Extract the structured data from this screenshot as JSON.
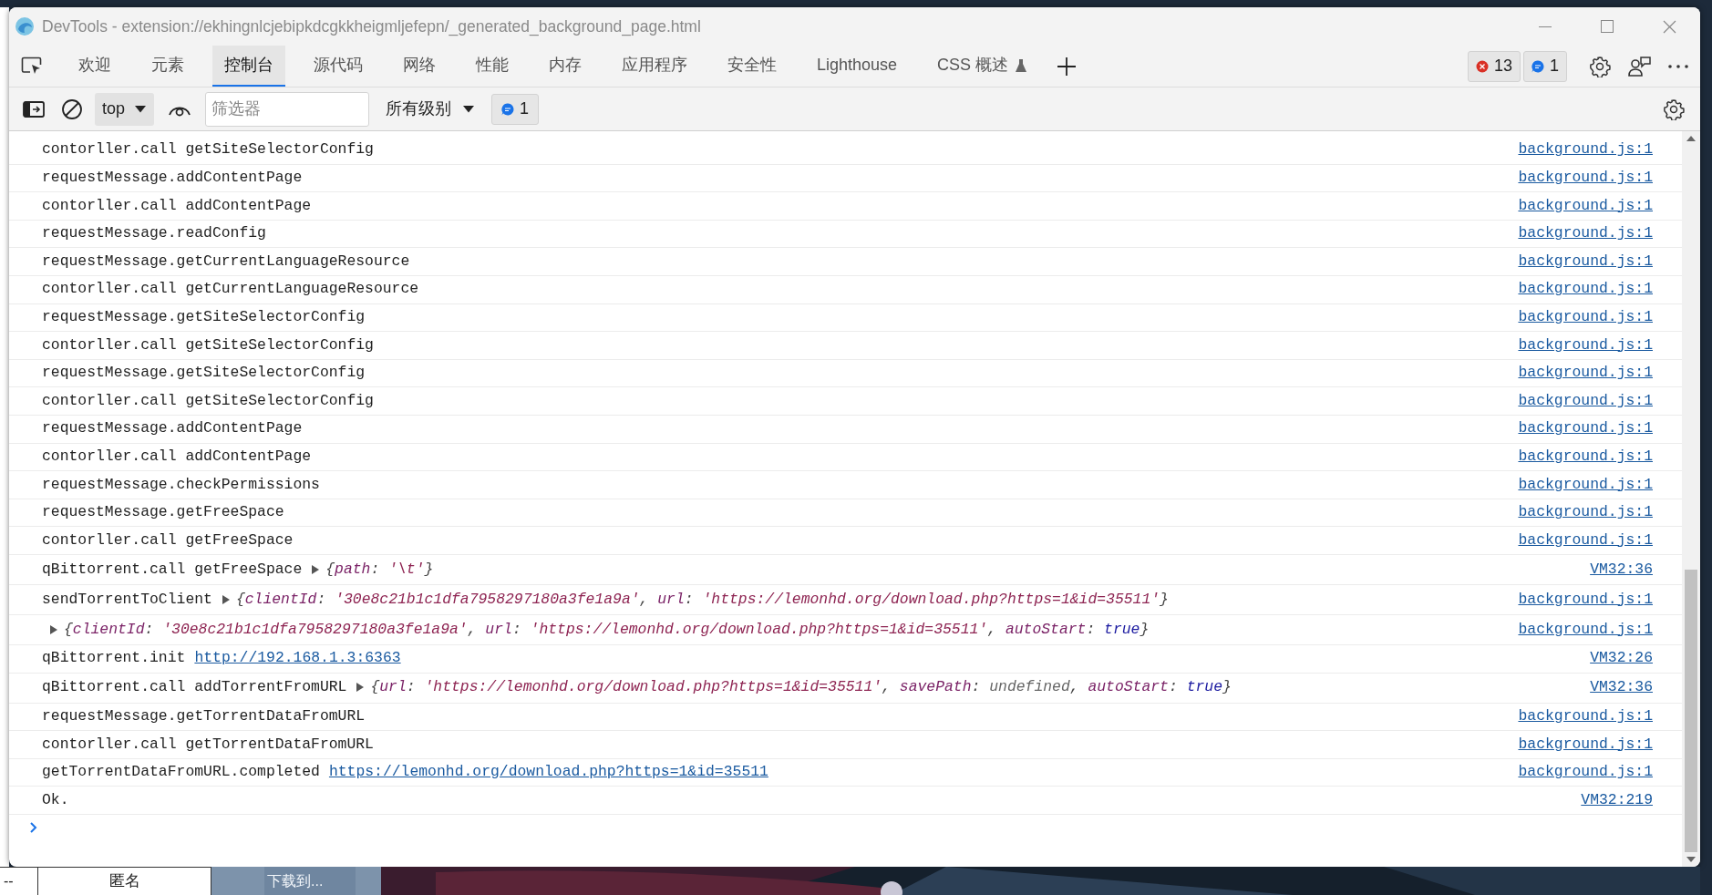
{
  "window": {
    "title": "DevTools - extension://ekhingnlcjebipkdcgkkheigmljefepn/_generated_background_page.html"
  },
  "tabs": [
    {
      "label": "欢迎",
      "selected": false,
      "kind": "plain"
    },
    {
      "label": "元素",
      "selected": false,
      "kind": "plain"
    },
    {
      "label": "控制台",
      "selected": true,
      "kind": "plain"
    },
    {
      "label": "源代码",
      "selected": false,
      "kind": "plain"
    },
    {
      "label": "网络",
      "selected": false,
      "kind": "plain"
    },
    {
      "label": "性能",
      "selected": false,
      "kind": "plain"
    },
    {
      "label": "内存",
      "selected": false,
      "kind": "plain"
    },
    {
      "label": "应用程序",
      "selected": false,
      "kind": "plain"
    },
    {
      "label": "安全性",
      "selected": false,
      "kind": "plain"
    },
    {
      "label": "Lighthouse",
      "selected": false,
      "kind": "plain"
    },
    {
      "label": "CSS 概述",
      "selected": false,
      "kind": "experimental"
    }
  ],
  "status_badges": [
    {
      "kind": "error",
      "count": "13"
    },
    {
      "kind": "info",
      "count": "1"
    }
  ],
  "toolbar": {
    "context": "top",
    "filter_placeholder": "筛选器",
    "levels": "所有级别",
    "message_badge": "1"
  },
  "messages": [
    {
      "parts": [
        {
          "kind": "text",
          "text": "contorller.call getSiteSelectorConfig"
        }
      ],
      "source": "background.js:1"
    },
    {
      "parts": [
        {
          "kind": "text",
          "text": "requestMessage.addContentPage"
        }
      ],
      "source": "background.js:1"
    },
    {
      "parts": [
        {
          "kind": "text",
          "text": "contorller.call addContentPage"
        }
      ],
      "source": "background.js:1"
    },
    {
      "parts": [
        {
          "kind": "text",
          "text": "requestMessage.readConfig"
        }
      ],
      "source": "background.js:1"
    },
    {
      "parts": [
        {
          "kind": "text",
          "text": "requestMessage.getCurrentLanguageResource"
        }
      ],
      "source": "background.js:1"
    },
    {
      "parts": [
        {
          "kind": "text",
          "text": "contorller.call getCurrentLanguageResource"
        }
      ],
      "source": "background.js:1"
    },
    {
      "parts": [
        {
          "kind": "text",
          "text": "requestMessage.getSiteSelectorConfig"
        }
      ],
      "source": "background.js:1"
    },
    {
      "parts": [
        {
          "kind": "text",
          "text": "contorller.call getSiteSelectorConfig"
        }
      ],
      "source": "background.js:1"
    },
    {
      "parts": [
        {
          "kind": "text",
          "text": "requestMessage.getSiteSelectorConfig"
        }
      ],
      "source": "background.js:1"
    },
    {
      "parts": [
        {
          "kind": "text",
          "text": "contorller.call getSiteSelectorConfig"
        }
      ],
      "source": "background.js:1"
    },
    {
      "parts": [
        {
          "kind": "text",
          "text": "requestMessage.addContentPage"
        }
      ],
      "source": "background.js:1"
    },
    {
      "parts": [
        {
          "kind": "text",
          "text": "contorller.call addContentPage"
        }
      ],
      "source": "background.js:1"
    },
    {
      "parts": [
        {
          "kind": "text",
          "text": "requestMessage.checkPermissions"
        }
      ],
      "source": "background.js:1"
    },
    {
      "parts": [
        {
          "kind": "text",
          "text": "requestMessage.getFreeSpace"
        }
      ],
      "source": "background.js:1"
    },
    {
      "parts": [
        {
          "kind": "text",
          "text": "contorller.call getFreeSpace"
        }
      ],
      "source": "background.js:1"
    },
    {
      "parts": [
        {
          "kind": "text",
          "text": "qBittorrent.call getFreeSpace"
        },
        {
          "kind": "object",
          "expanded": false,
          "tokens": [
            {
              "kind": "punct",
              "text": "{"
            },
            {
              "kind": "key",
              "text": "path"
            },
            {
              "kind": "punct",
              "text": ": "
            },
            {
              "kind": "string",
              "text": "'\\t'"
            },
            {
              "kind": "punct",
              "text": "}"
            }
          ]
        }
      ],
      "source": "VM32:36"
    },
    {
      "parts": [
        {
          "kind": "text",
          "text": "sendTorrentToClient"
        },
        {
          "kind": "object",
          "expanded": false,
          "tokens": [
            {
              "kind": "punct",
              "text": "{"
            },
            {
              "kind": "key",
              "text": "clientId"
            },
            {
              "kind": "punct",
              "text": ": "
            },
            {
              "kind": "string",
              "text": "'30e8c21b1c1dfa7958297180a3fe1a9a'"
            },
            {
              "kind": "punct",
              "text": ", "
            },
            {
              "kind": "key",
              "text": "url"
            },
            {
              "kind": "punct",
              "text": ": "
            },
            {
              "kind": "string",
              "text": "'https://lemonhd.org/download.php?https=1&id=35511'"
            },
            {
              "kind": "punct",
              "text": "}"
            }
          ]
        }
      ],
      "source": "background.js:1"
    },
    {
      "parts": [
        {
          "kind": "object",
          "expanded": false,
          "tokens": [
            {
              "kind": "punct",
              "text": "{"
            },
            {
              "kind": "key",
              "text": "clientId"
            },
            {
              "kind": "punct",
              "text": ": "
            },
            {
              "kind": "string",
              "text": "'30e8c21b1c1dfa7958297180a3fe1a9a'"
            },
            {
              "kind": "punct",
              "text": ", "
            },
            {
              "kind": "key",
              "text": "url"
            },
            {
              "kind": "punct",
              "text": ": "
            },
            {
              "kind": "string",
              "text": "'https://lemonhd.org/download.php?https=1&id=35511'"
            },
            {
              "kind": "punct",
              "text": ", "
            },
            {
              "kind": "key",
              "text": "autoStart"
            },
            {
              "kind": "punct",
              "text": ": "
            },
            {
              "kind": "boolean",
              "text": "true"
            },
            {
              "kind": "punct",
              "text": "}"
            }
          ]
        }
      ],
      "source": "background.js:1"
    },
    {
      "parts": [
        {
          "kind": "text",
          "text": "qBittorrent.init"
        },
        {
          "kind": "link",
          "text": "http://192.168.1.3:6363"
        }
      ],
      "source": "VM32:26"
    },
    {
      "parts": [
        {
          "kind": "text",
          "text": "qBittorrent.call addTorrentFromURL"
        },
        {
          "kind": "object",
          "expanded": false,
          "tokens": [
            {
              "kind": "punct",
              "text": "{"
            },
            {
              "kind": "key",
              "text": "url"
            },
            {
              "kind": "punct",
              "text": ": "
            },
            {
              "kind": "string",
              "text": "'https://lemonhd.org/download.php?https=1&id=35511'"
            },
            {
              "kind": "punct",
              "text": ", "
            },
            {
              "kind": "key",
              "text": "savePath"
            },
            {
              "kind": "punct",
              "text": ": "
            },
            {
              "kind": "undefined",
              "text": "undefined"
            },
            {
              "kind": "punct",
              "text": ", "
            },
            {
              "kind": "key",
              "text": "autoStart"
            },
            {
              "kind": "punct",
              "text": ": "
            },
            {
              "kind": "boolean",
              "text": "true"
            },
            {
              "kind": "punct",
              "text": "}"
            }
          ]
        }
      ],
      "source": "VM32:36"
    },
    {
      "parts": [
        {
          "kind": "text",
          "text": "requestMessage.getTorrentDataFromURL"
        }
      ],
      "source": "background.js:1"
    },
    {
      "parts": [
        {
          "kind": "text",
          "text": "contorller.call getTorrentDataFromURL"
        }
      ],
      "source": "background.js:1"
    },
    {
      "parts": [
        {
          "kind": "text",
          "text": "getTorrentDataFromURL.completed"
        },
        {
          "kind": "link",
          "text": "https://lemonhd.org/download.php?https=1&id=35511"
        }
      ],
      "source": "background.js:1"
    },
    {
      "parts": [
        {
          "kind": "text",
          "text": "Ok."
        }
      ],
      "source": "VM32:219"
    }
  ],
  "background_table": {
    "cells": [
      "--",
      "匿名"
    ],
    "button": "下载到..."
  }
}
